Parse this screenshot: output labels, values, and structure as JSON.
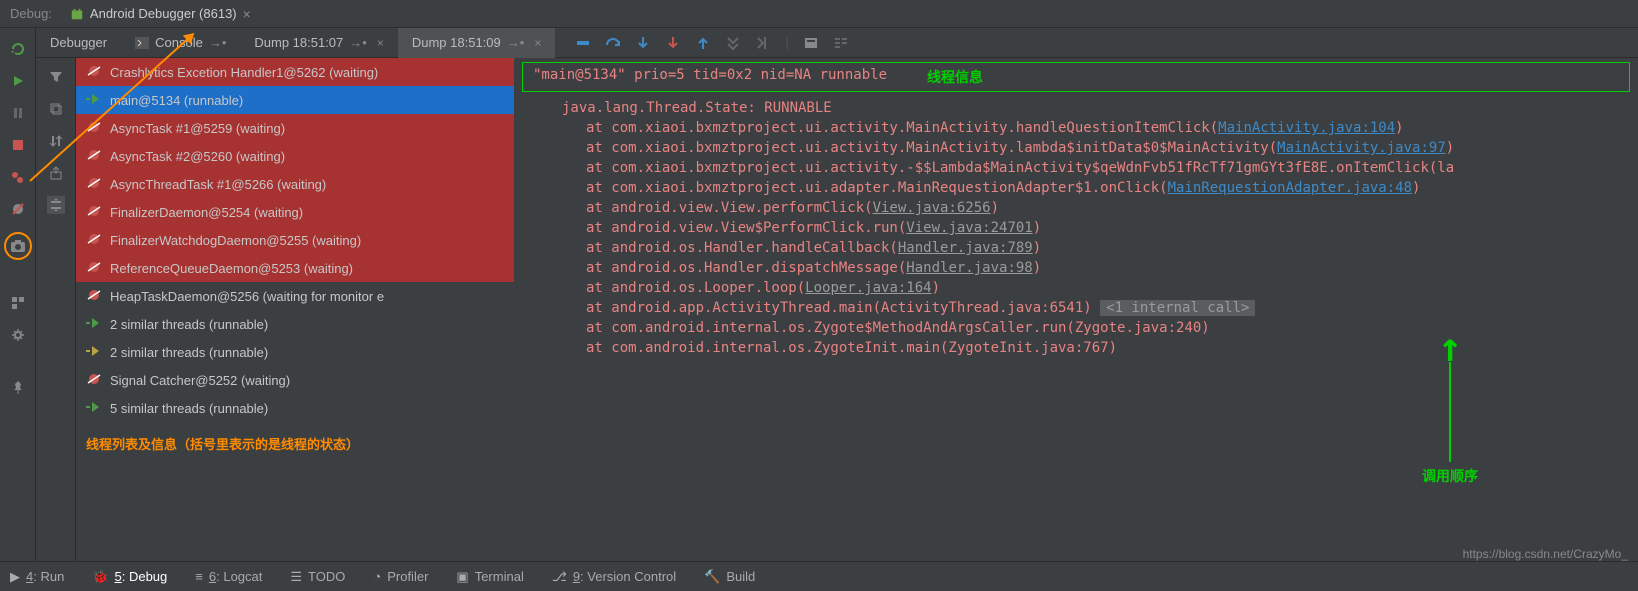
{
  "top": {
    "label": "Debug:",
    "session": "Android Debugger (8613)"
  },
  "tabs": {
    "debugger": "Debugger",
    "console": "Console",
    "dump1": "Dump 18:51:07",
    "dump2": "Dump 18:51:09"
  },
  "threads": [
    {
      "name": "Crashlytics Excetion Handler1@5262 (waiting)",
      "icon": "pause",
      "cls": "grp1"
    },
    {
      "name": "main@5134 (runnable)",
      "icon": "run",
      "cls": "selected"
    },
    {
      "name": "AsyncTask #1@5259 (waiting)",
      "icon": "pause",
      "cls": "grp1"
    },
    {
      "name": "AsyncTask #2@5260 (waiting)",
      "icon": "pause",
      "cls": "grp1"
    },
    {
      "name": "AsyncThreadTask #1@5266 (waiting)",
      "icon": "pause",
      "cls": "grp1"
    },
    {
      "name": "FinalizerDaemon@5254 (waiting)",
      "icon": "pause",
      "cls": "grp1"
    },
    {
      "name": "FinalizerWatchdogDaemon@5255 (waiting)",
      "icon": "pause",
      "cls": "grp1"
    },
    {
      "name": "ReferenceQueueDaemon@5253 (waiting)",
      "icon": "pause",
      "cls": "grp1"
    },
    {
      "name": "HeapTaskDaemon@5256 (waiting for monitor e",
      "icon": "pause",
      "cls": ""
    },
    {
      "name": "2 similar threads (runnable)",
      "icon": "run",
      "cls": ""
    },
    {
      "name": "2 similar threads (runnable)",
      "icon": "runx",
      "cls": ""
    },
    {
      "name": "Signal Catcher@5252 (waiting)",
      "icon": "pause",
      "cls": ""
    },
    {
      "name": "5 similar threads (runnable)",
      "icon": "run",
      "cls": ""
    }
  ],
  "thread_caption": "线程列表及信息（括号里表示的是线程的状态）",
  "stack": {
    "header": "\"main@5134\" prio=5 tid=0x2 nid=NA runnable",
    "header_label": "线程信息",
    "state": "java.lang.Thread.State: RUNNABLE",
    "frames": [
      {
        "prefix": "at com.xiaoi.bxmztproject.ui.activity.MainActivity.handleQuestionItemClick(",
        "link": "MainActivity.java:104",
        "suffix": ")",
        "type": "link"
      },
      {
        "prefix": "at com.xiaoi.bxmztproject.ui.activity.MainActivity.lambda$initData$0$MainActivity(",
        "link": "MainActivity.java:97",
        "suffix": ")",
        "type": "link"
      },
      {
        "prefix": "at com.xiaoi.bxmztproject.ui.activity.-$$Lambda$MainActivity$qeWdnFvb51fRcTf71gmGYt3fE8E.onItemClick(la",
        "link": "",
        "suffix": "",
        "type": "none"
      },
      {
        "prefix": "at com.xiaoi.bxmztproject.ui.adapter.MainRequestionAdapter$1.onClick(",
        "link": "MainRequestionAdapter.java:48",
        "suffix": ")",
        "type": "link"
      },
      {
        "prefix": "at android.view.View.performClick(",
        "link": "View.java:6256",
        "suffix": ")",
        "type": "gray"
      },
      {
        "prefix": "at android.view.View$PerformClick.run(",
        "link": "View.java:24701",
        "suffix": ")",
        "type": "gray"
      },
      {
        "prefix": "at android.os.Handler.handleCallback(",
        "link": "Handler.java:789",
        "suffix": ")",
        "type": "gray"
      },
      {
        "prefix": "at android.os.Handler.dispatchMessage(",
        "link": "Handler.java:98",
        "suffix": ")",
        "type": "gray"
      },
      {
        "prefix": "at android.os.Looper.loop(",
        "link": "Looper.java:164",
        "suffix": ")",
        "type": "gray"
      },
      {
        "prefix": "at android.app.ActivityThread.main(ActivityThread.java:6541) ",
        "link": "",
        "suffix": "",
        "type": "internal",
        "internal": "<1 internal call>"
      },
      {
        "prefix": "at com.android.internal.os.Zygote$MethodAndArgsCaller.run(Zygote.java:240)",
        "link": "",
        "suffix": "",
        "type": "none"
      },
      {
        "prefix": "at com.android.internal.os.ZygoteInit.main(ZygoteInit.java:767)",
        "link": "",
        "suffix": "",
        "type": "none"
      }
    ],
    "call_order": "调用顺序"
  },
  "bottom": {
    "run": "4: Run",
    "debug": "5: Debug",
    "logcat": "6: Logcat",
    "todo": "TODO",
    "profiler": "Profiler",
    "terminal": "Terminal",
    "vc": "9: Version Control",
    "build": "Build"
  },
  "watermark": "https://blog.csdn.net/CrazyMo_"
}
